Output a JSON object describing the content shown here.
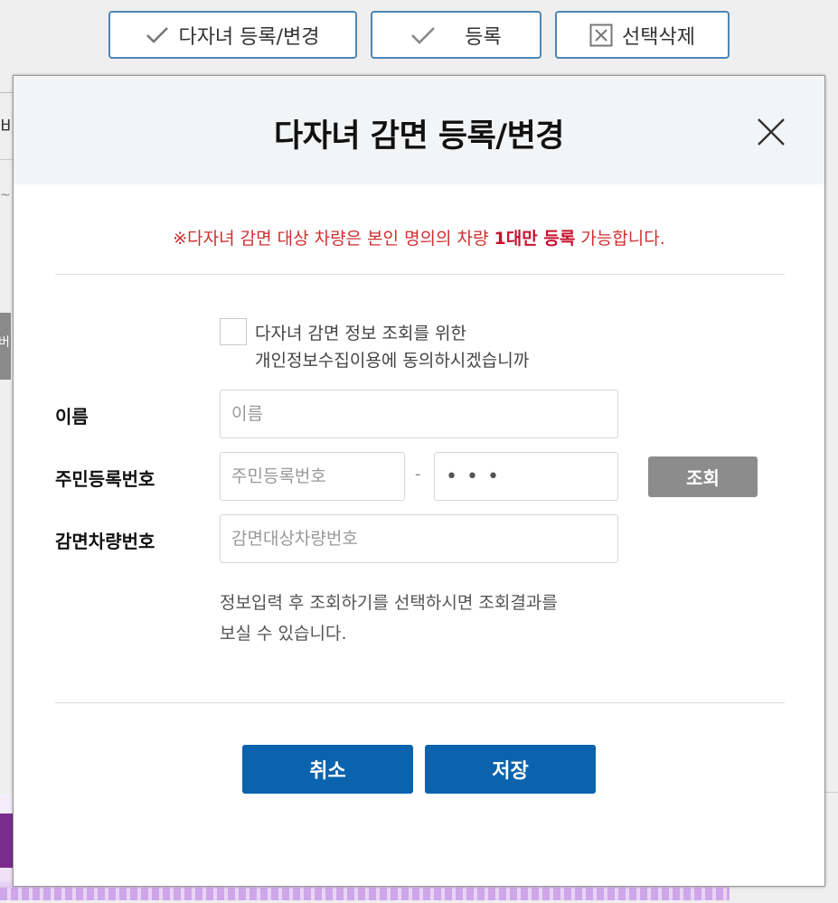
{
  "toolbar": {
    "multichild_label": "다자녀 등록/변경",
    "register_label": "등록",
    "delete_label": "선택삭제"
  },
  "background": {
    "left_fragment": "비",
    "tab_fragment": "버"
  },
  "modal": {
    "title": "다자녀 감면 등록/변경",
    "notice_prefix": "※다자녀 감면 대상 차량은 본인 명의의 차량 ",
    "notice_emphasis": "1대만 등록",
    "notice_suffix": " 가능합니다.",
    "agree_line1": "다자녀 감면 정보 조회를 위한",
    "agree_line2": "개인정보수집이용에 동의하시겠습니까",
    "name_label": "이름",
    "name_placeholder": "이름",
    "rrn_label": "주민등록번호",
    "rrn_front_placeholder": "주민등록번호",
    "rrn_separator": "-",
    "rrn_back_value": "•••",
    "lookup_label": "조회",
    "car_label": "감면차량번호",
    "car_placeholder": "감면대상차량번호",
    "help_line1": "정보입력 후 조회하기를 선택하시면 조회결과를",
    "help_line2": "보실 수 있습니다.",
    "cancel_label": "취소",
    "save_label": "저장"
  },
  "colors": {
    "primary_button": "#0b63ad",
    "lookup_button": "#8c8c8c",
    "notice_text": "#d12f2f",
    "toolbar_border": "#4f86b4"
  },
  "icons": {
    "toolbar_multichild": "check-icon",
    "toolbar_register": "check-icon",
    "toolbar_delete": "x-box-icon",
    "modal_close": "close-icon"
  }
}
